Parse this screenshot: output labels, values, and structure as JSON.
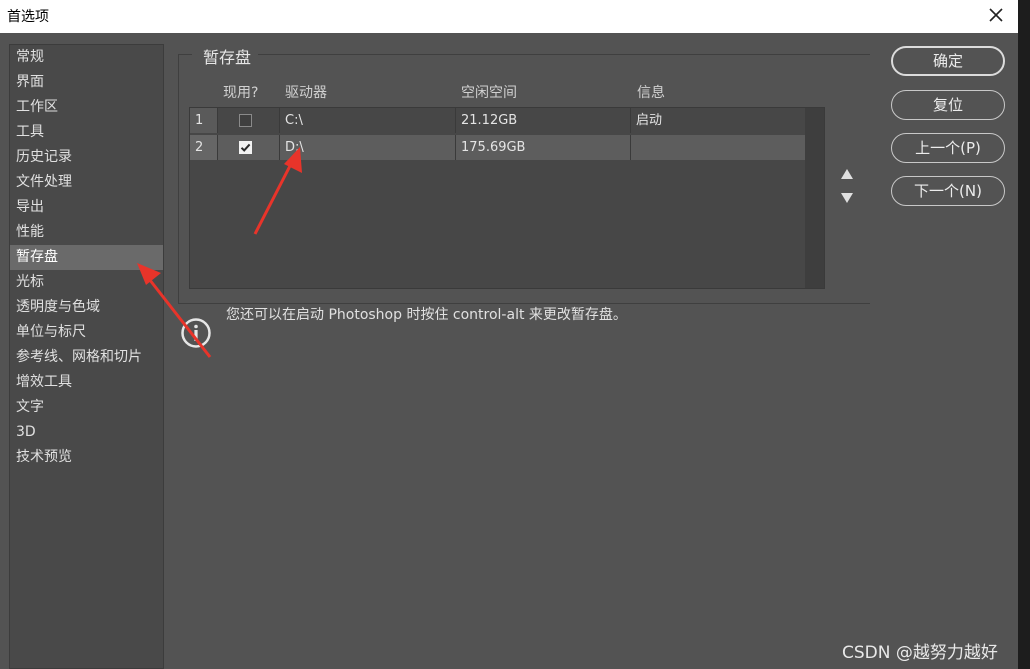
{
  "window": {
    "title": "首选项"
  },
  "sidebar": {
    "items": [
      {
        "label": "常规"
      },
      {
        "label": "界面"
      },
      {
        "label": "工作区"
      },
      {
        "label": "工具"
      },
      {
        "label": "历史记录"
      },
      {
        "label": "文件处理"
      },
      {
        "label": "导出"
      },
      {
        "label": "性能"
      },
      {
        "label": "暂存盘",
        "active": true
      },
      {
        "label": "光标"
      },
      {
        "label": "透明度与色域"
      },
      {
        "label": "单位与标尺"
      },
      {
        "label": "参考线、网格和切片"
      },
      {
        "label": "增效工具"
      },
      {
        "label": "文字"
      },
      {
        "label": "3D"
      },
      {
        "label": "技术预览"
      }
    ]
  },
  "scratch": {
    "title": "暂存盘",
    "headers": {
      "active": "现用?",
      "drive": "驱动器",
      "free": "空闲空间",
      "info": "信息"
    },
    "rows": [
      {
        "num": "1",
        "checked": false,
        "drive": "C:\\",
        "free": "21.12GB",
        "info": "启动"
      },
      {
        "num": "2",
        "checked": true,
        "drive": "D:\\",
        "free": "175.69GB",
        "info": ""
      }
    ]
  },
  "info_text": "您还可以在启动 Photoshop 时按住 control-alt 来更改暂存盘。",
  "buttons": {
    "ok": "确定",
    "reset": "复位",
    "prev": "上一个(P)",
    "next": "下一个(N)"
  },
  "watermark": "CSDN @越努力越好",
  "colors": {
    "annotation_arrow": "#e8342a",
    "selected_row": "#5d5d5d",
    "background": "#535353"
  }
}
